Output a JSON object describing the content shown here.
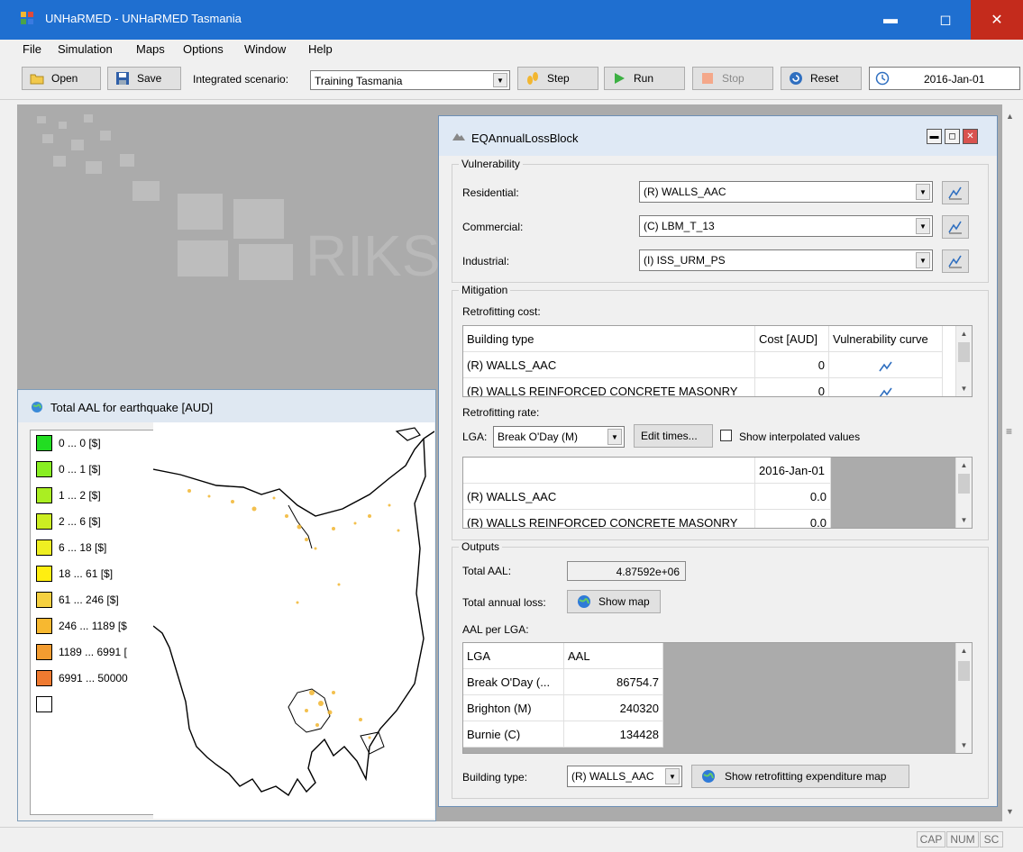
{
  "window": {
    "title": "UNHaRMED - UNHaRMED Tasmania",
    "minimize": "▬",
    "maximize": "◻",
    "close": "✕"
  },
  "menu": [
    "File",
    "Simulation",
    "Maps",
    "Options",
    "Window",
    "Help"
  ],
  "toolbar": {
    "open": "Open",
    "save": "Save",
    "scenario_label": "Integrated scenario:",
    "scenario_value": "Training Tasmania",
    "step": "Step",
    "run": "Run",
    "stop": "Stop",
    "reset": "Reset",
    "date": "2016-Jan-01"
  },
  "workspace": {
    "watermark": "RIKS"
  },
  "map_window": {
    "title": "Total AAL for earthquake [AUD]",
    "legend": [
      {
        "label": "0 ... 0 [$]",
        "color": "#22dd22"
      },
      {
        "label": "0 ... 1 [$]",
        "color": "#88ee22"
      },
      {
        "label": "1 ... 2 [$]",
        "color": "#aaee22"
      },
      {
        "label": "2 ... 6 [$]",
        "color": "#ccee22"
      },
      {
        "label": "6 ... 18 [$]",
        "color": "#eeee22"
      },
      {
        "label": "18 ... 61 [$]",
        "color": "#ffee11"
      },
      {
        "label": "61 ... 246 [$]",
        "color": "#f5d040"
      },
      {
        "label": "246 ... 1189 [$",
        "color": "#f7b830"
      },
      {
        "label": "1189 ... 6991 [",
        "color": "#f39c30"
      },
      {
        "label": "6991 ... 50000",
        "color": "#ef7a30"
      },
      {
        "label": "",
        "color": "#ffffff"
      }
    ]
  },
  "dialog": {
    "title": "EQAnnualLossBlock",
    "vulnerability": {
      "group": "Vulnerability",
      "residential_label": "Residential:",
      "residential_value": "(R) WALLS_AAC",
      "commercial_label": "Commercial:",
      "commercial_value": "(C) LBM_T_13",
      "industrial_label": "Industrial:",
      "industrial_value": "(I) ISS_URM_PS"
    },
    "mitigation": {
      "group": "Mitigation",
      "cost_label": "Retrofitting cost:",
      "cost_headers": [
        "Building type",
        "Cost [AUD]",
        "Vulnerability curve"
      ],
      "cost_rows": [
        {
          "type": "(R) WALLS_AAC",
          "cost": "0"
        },
        {
          "type": "(R) WALLS REINFORCED CONCRETE MASONRY",
          "cost": "0"
        }
      ],
      "rate_label": "Retrofitting rate:",
      "lga_label": "LGA:",
      "lga_value": "Break O'Day (M)",
      "edit_times": "Edit times...",
      "show_interp": "Show interpolated values",
      "rate_header": "2016-Jan-01",
      "rate_rows": [
        {
          "type": "(R) WALLS_AAC",
          "value": "0.0"
        },
        {
          "type": "(R) WALLS REINFORCED CONCRETE MASONRY",
          "value": "0.0"
        }
      ]
    },
    "outputs": {
      "group": "Outputs",
      "total_aal_label": "Total AAL:",
      "total_aal_value": "4.87592e+06",
      "annual_loss_label": "Total annual loss:",
      "show_map": "Show map",
      "aal_lga_label": "AAL per LGA:",
      "lga_headers": [
        "LGA",
        "AAL"
      ],
      "lga_rows": [
        {
          "lga": "Break O'Day (...",
          "aal": "86754.7"
        },
        {
          "lga": "Brighton (M)",
          "aal": "240320"
        },
        {
          "lga": "Burnie (C)",
          "aal": "134428"
        }
      ],
      "building_type_label": "Building type:",
      "building_type_value": "(R) WALLS_AAC",
      "show_retro_map": "Show retrofitting expenditure map"
    }
  },
  "status": {
    "cap": "CAP",
    "num": "NUM",
    "scrl": "SC"
  }
}
